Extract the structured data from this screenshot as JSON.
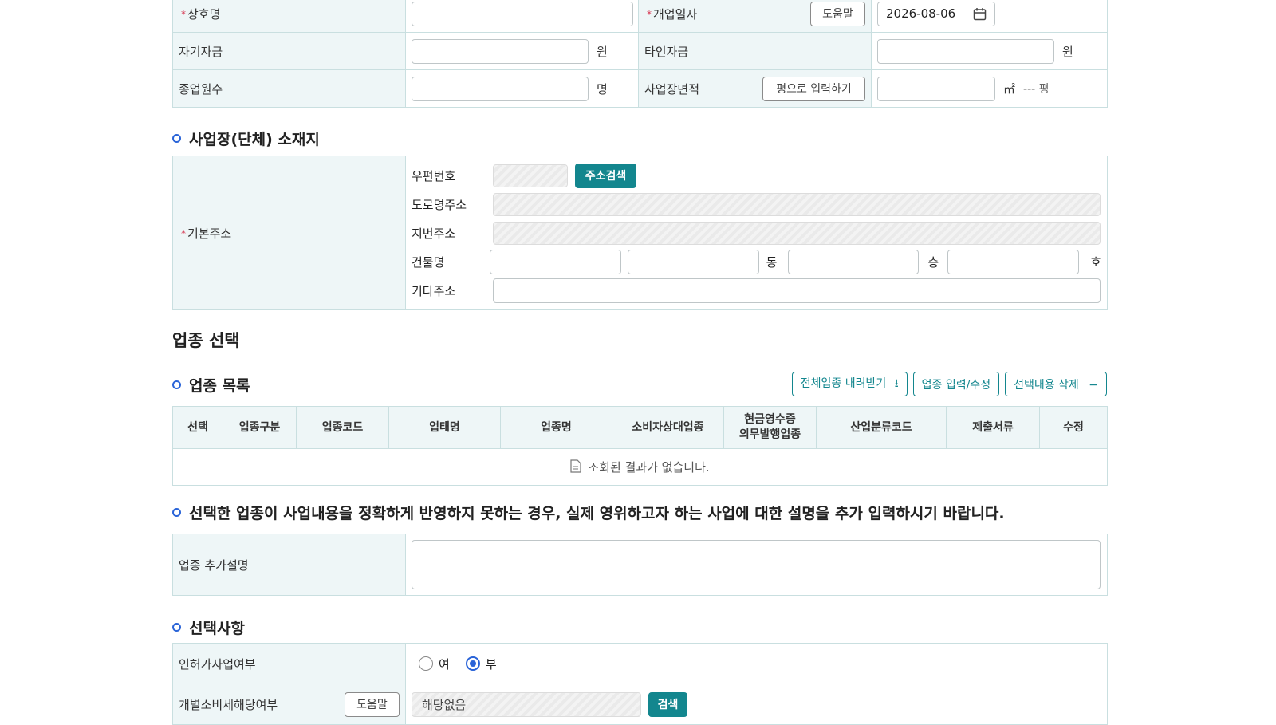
{
  "basic": {
    "company_name_label": "상호명",
    "open_date_label": "개업일자",
    "help_label": "도움말",
    "open_date_value": "2026-08-06",
    "own_fund_label": "자기자금",
    "other_fund_label": "타인자금",
    "won_unit": "원",
    "employees_label": "종업원수",
    "person_unit": "명",
    "area_label": "사업장면적",
    "pyeong_input_button": "평으로 입력하기",
    "sqm_unit": "㎡",
    "pyeong_display": "--- 평"
  },
  "address": {
    "section_title": "사업장(단체) 소재지",
    "base_label": "기본주소",
    "zip_label": "우편번호",
    "search_button": "주소검색",
    "road_label": "도로명주소",
    "jibun_label": "지번주소",
    "building_label": "건물명",
    "dong_unit": "동",
    "floor_unit": "층",
    "ho_unit": "호",
    "etc_label": "기타주소"
  },
  "industry": {
    "heading": "업종 선택",
    "list_title": "업종 목록",
    "download_button": "전체업종 내려받기",
    "edit_button": "업종 입력/수정",
    "delete_button": "선택내용 삭제",
    "columns": [
      "선택",
      "업종구분",
      "업종코드",
      "업태명",
      "업종명",
      "소비자상대업종",
      "현금영수증\n의무발행업종",
      "산업분류코드",
      "제출서류",
      "수정"
    ],
    "empty_message": "조회된 결과가 없습니다."
  },
  "description": {
    "notice": "선택한 업종이 사업내용을 정확하게 반영하지 못하는 경우, 실제 영위하고자 하는 사업에 대한 설명을 추가 입력하시기 바랍니다.",
    "label": "업종 추가설명"
  },
  "options": {
    "section_title": "선택사항",
    "license_label": "인허가사업여부",
    "yes_label": "여",
    "no_label": "부",
    "selected": "부",
    "excise_label": "개별소비세해당여부",
    "help_label": "도움말",
    "excise_value": "해당없음",
    "search_button": "검색"
  },
  "colors": {
    "teal": "#13868e",
    "required": "#d6304b",
    "bullet": "#2a64d8"
  }
}
